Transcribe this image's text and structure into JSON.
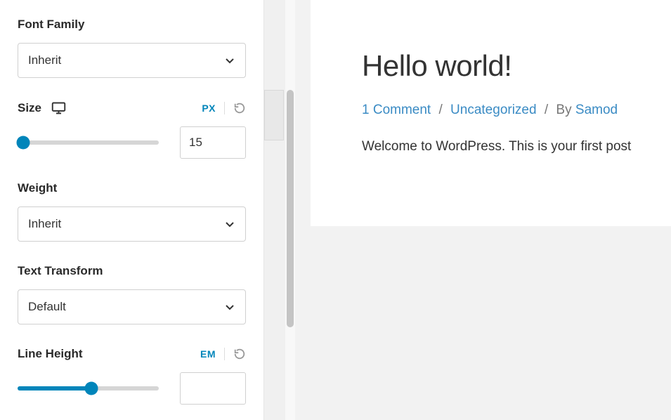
{
  "sidebar": {
    "fontFamily": {
      "label": "Font Family",
      "value": "Inherit"
    },
    "size": {
      "label": "Size",
      "unit": "PX",
      "value": "15",
      "sliderPercent": 4
    },
    "weight": {
      "label": "Weight",
      "value": "Inherit"
    },
    "textTransform": {
      "label": "Text Transform",
      "value": "Default"
    },
    "lineHeight": {
      "label": "Line Height",
      "unit": "EM",
      "value": "",
      "sliderPercent": 52
    }
  },
  "preview": {
    "title": "Hello world!",
    "meta": {
      "comments": "1 Comment",
      "category": "Uncategorized",
      "byLabel": "By",
      "author": "Samod"
    },
    "body": "Welcome to WordPress. This is your first post"
  }
}
